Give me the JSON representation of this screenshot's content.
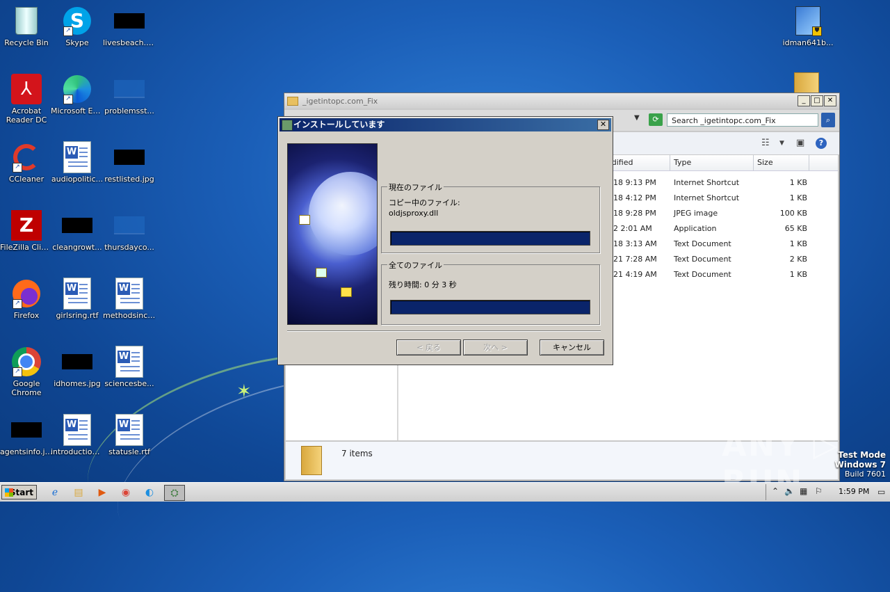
{
  "desktop": {
    "icons": [
      {
        "label": "Recycle Bin"
      },
      {
        "label": "Skype"
      },
      {
        "label": "livesbeach.jpg"
      },
      {
        "label": "Acrobat Reader DC"
      },
      {
        "label": "Microsoft Edge"
      },
      {
        "label": "problemsst..."
      },
      {
        "label": "CCleaner"
      },
      {
        "label": "audiopolitic..."
      },
      {
        "label": "restlisted.jpg"
      },
      {
        "label": "FileZilla Client"
      },
      {
        "label": "cleangrowt..."
      },
      {
        "label": "thursdayco..."
      },
      {
        "label": "Firefox"
      },
      {
        "label": "girlsring.rtf"
      },
      {
        "label": "methodsinc.rtf"
      },
      {
        "label": "Google Chrome"
      },
      {
        "label": "idhomes.jpg"
      },
      {
        "label": "sciencesbe..."
      },
      {
        "label": "agentsinfo.jpg"
      },
      {
        "label": "introduction..."
      },
      {
        "label": "statusle.rtf"
      },
      {
        "label": "idman641b..."
      }
    ]
  },
  "explorer": {
    "title": "_igetintopc.com_Fix",
    "search_placeholder": "Search _igetintopc.com_Fix",
    "columns": [
      "odified",
      "Type",
      "Size"
    ],
    "rows": [
      {
        "modified": "018 9:13 PM",
        "type": "Internet Shortcut",
        "size": "1 KB"
      },
      {
        "modified": "018 4:12 PM",
        "type": "Internet Shortcut",
        "size": "1 KB"
      },
      {
        "modified": "018 9:28 PM",
        "type": "JPEG image",
        "size": "100 KB"
      },
      {
        "modified": "22 2:01 AM",
        "type": "Application",
        "size": "65 KB"
      },
      {
        "modified": "018 3:13 AM",
        "type": "Text Document",
        "size": "1 KB"
      },
      {
        "modified": "021 7:28 AM",
        "type": "Text Document",
        "size": "2 KB"
      },
      {
        "modified": "021 4:19 AM",
        "type": "Text Document",
        "size": "1 KB"
      }
    ],
    "status": "7 items"
  },
  "dialog": {
    "title": "インストールしています",
    "current_group": "現在のファイル",
    "copying_label": "コピー中のファイル:",
    "current_file": "oldjsproxy.dll",
    "current_progress": 1.0,
    "all_group": "全てのファイル",
    "remaining": "残り時間: 0 分 3 秒",
    "all_progress": 1.0,
    "back_button": "< 戻る",
    "next_button": "次へ >",
    "cancel_button": "キャンセル"
  },
  "watermark": {
    "brand": "ANY ▷ RUN",
    "test_mode": "Test Mode",
    "os": "Windows 7",
    "build": "Build 7601"
  },
  "taskbar": {
    "start_label": "Start",
    "clock": "1:59 PM"
  }
}
